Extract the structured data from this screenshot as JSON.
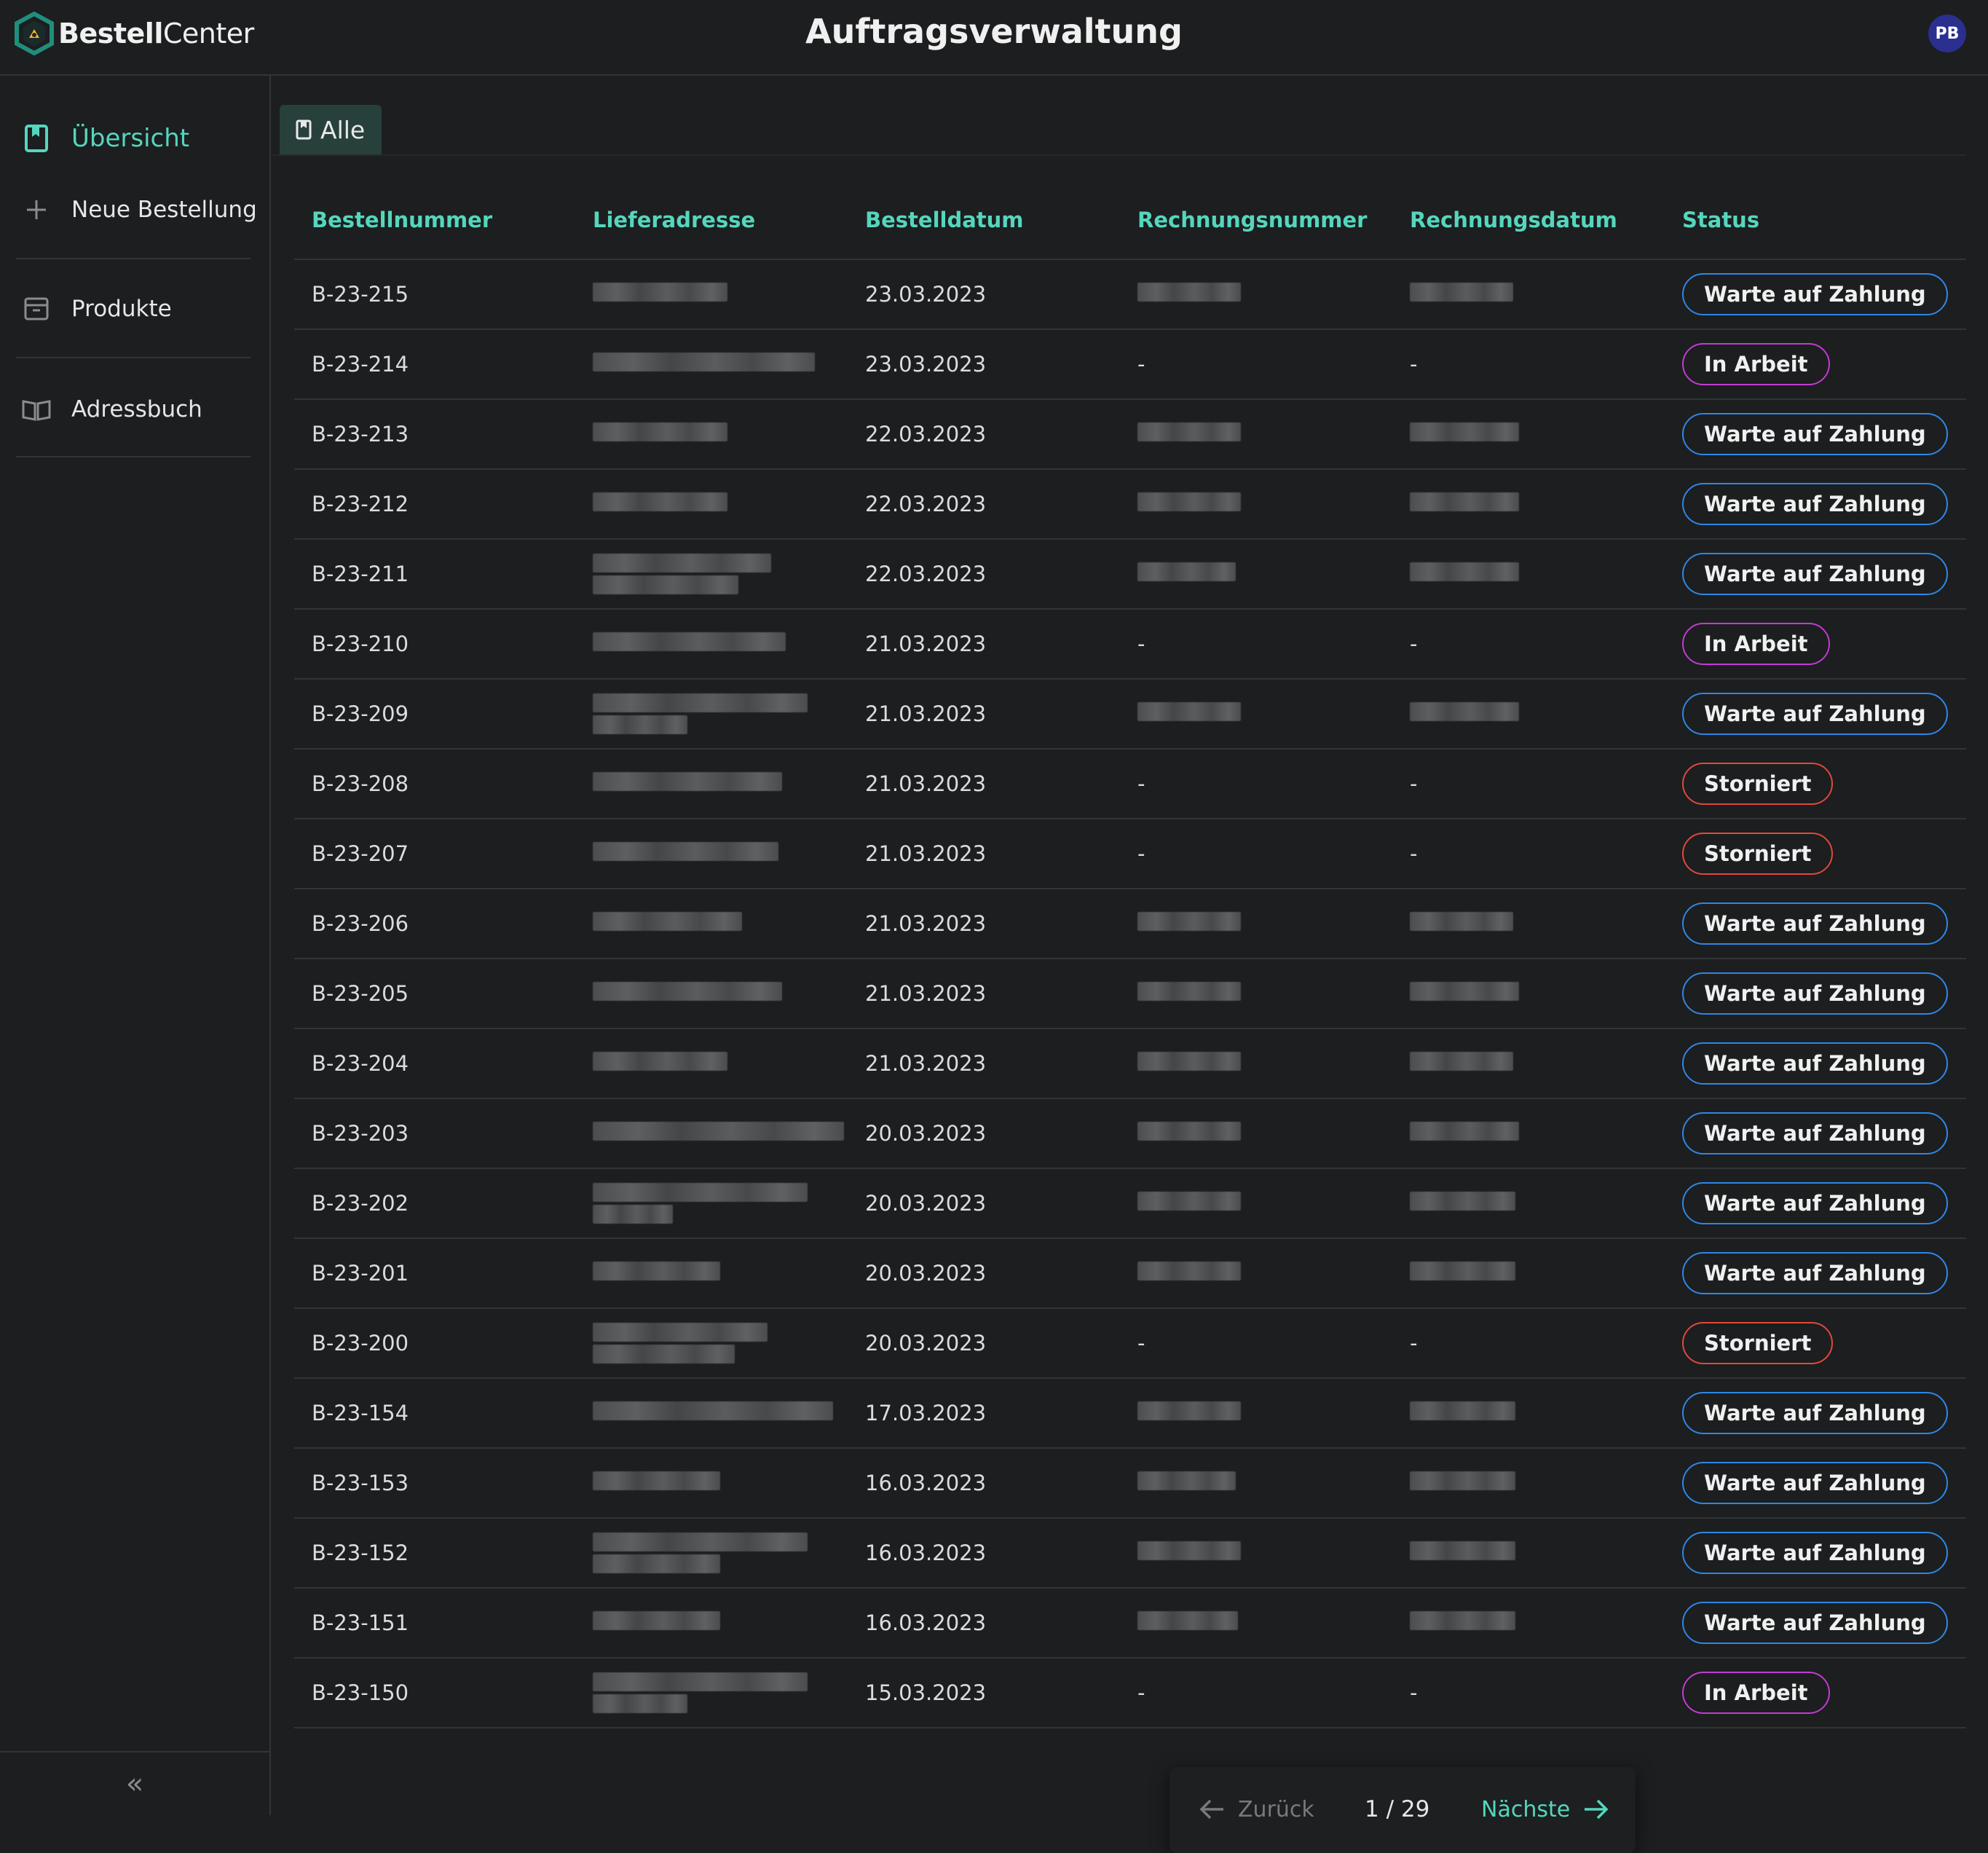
{
  "app": {
    "brand_bold": "Bestell",
    "brand_light": "Center",
    "page_title": "Auftragsverwaltung",
    "avatar_initials": "PB"
  },
  "sidebar": {
    "items": [
      {
        "label": "Übersicht",
        "icon": "bookmark-icon",
        "active": true
      },
      {
        "label": "Neue Bestellung",
        "icon": "plus-icon"
      },
      {
        "label": "Produkte",
        "icon": "archive-icon"
      },
      {
        "label": "Adressbuch",
        "icon": "open-book-icon"
      }
    ],
    "collapse_label": "«"
  },
  "tabs": [
    {
      "label": "Alle",
      "icon": "bookmark-icon"
    }
  ],
  "table": {
    "columns": [
      "Bestellnummer",
      "Lieferadresse",
      "Bestelldatum",
      "Rechnungsnummer",
      "Rechnungsdatum",
      "Status"
    ],
    "rows": [
      {
        "id": "B-23-215",
        "date": "23.03.2023",
        "inv_no": "",
        "inv_date": "",
        "status": "Warte auf Zahlung",
        "tone": "blue"
      },
      {
        "id": "B-23-214",
        "date": "23.03.2023",
        "inv_no": "-",
        "inv_date": "-",
        "status": "In Arbeit",
        "tone": "purple"
      },
      {
        "id": "B-23-213",
        "date": "22.03.2023",
        "inv_no": "",
        "inv_date": "",
        "status": "Warte auf Zahlung",
        "tone": "blue"
      },
      {
        "id": "B-23-212",
        "date": "22.03.2023",
        "inv_no": "",
        "inv_date": "",
        "status": "Warte auf Zahlung",
        "tone": "blue"
      },
      {
        "id": "B-23-211",
        "date": "22.03.2023",
        "inv_no": "",
        "inv_date": "",
        "status": "Warte auf Zahlung",
        "tone": "blue"
      },
      {
        "id": "B-23-210",
        "date": "21.03.2023",
        "inv_no": "-",
        "inv_date": "-",
        "status": "In Arbeit",
        "tone": "purple"
      },
      {
        "id": "B-23-209",
        "date": "21.03.2023",
        "inv_no": "",
        "inv_date": "",
        "status": "Warte auf Zahlung",
        "tone": "blue"
      },
      {
        "id": "B-23-208",
        "date": "21.03.2023",
        "inv_no": "-",
        "inv_date": "-",
        "status": "Storniert",
        "tone": "red"
      },
      {
        "id": "B-23-207",
        "date": "21.03.2023",
        "inv_no": "-",
        "inv_date": "-",
        "status": "Storniert",
        "tone": "red"
      },
      {
        "id": "B-23-206",
        "date": "21.03.2023",
        "inv_no": "",
        "inv_date": "",
        "status": "Warte auf Zahlung",
        "tone": "blue"
      },
      {
        "id": "B-23-205",
        "date": "21.03.2023",
        "inv_no": "",
        "inv_date": "",
        "status": "Warte auf Zahlung",
        "tone": "blue"
      },
      {
        "id": "B-23-204",
        "date": "21.03.2023",
        "inv_no": "",
        "inv_date": "",
        "status": "Warte auf Zahlung",
        "tone": "blue"
      },
      {
        "id": "B-23-203",
        "date": "20.03.2023",
        "inv_no": "",
        "inv_date": "",
        "status": "Warte auf Zahlung",
        "tone": "blue"
      },
      {
        "id": "B-23-202",
        "date": "20.03.2023",
        "inv_no": "",
        "inv_date": "",
        "status": "Warte auf Zahlung",
        "tone": "blue"
      },
      {
        "id": "B-23-201",
        "date": "20.03.2023",
        "inv_no": "",
        "inv_date": "",
        "status": "Warte auf Zahlung",
        "tone": "blue"
      },
      {
        "id": "B-23-200",
        "date": "20.03.2023",
        "inv_no": "-",
        "inv_date": "-",
        "status": "Storniert",
        "tone": "red"
      },
      {
        "id": "B-23-154",
        "date": "17.03.2023",
        "inv_no": "",
        "inv_date": "",
        "status": "Warte auf Zahlung",
        "tone": "blue"
      },
      {
        "id": "B-23-153",
        "date": "16.03.2023",
        "inv_no": "",
        "inv_date": "",
        "status": "Warte auf Zahlung",
        "tone": "blue"
      },
      {
        "id": "B-23-152",
        "date": "16.03.2023",
        "inv_no": "",
        "inv_date": "",
        "status": "Warte auf Zahlung",
        "tone": "blue"
      },
      {
        "id": "B-23-151",
        "date": "16.03.2023",
        "inv_no": "",
        "inv_date": "",
        "status": "Warte auf Zahlung",
        "tone": "blue"
      },
      {
        "id": "B-23-150",
        "date": "15.03.2023",
        "inv_no": "-",
        "inv_date": "-",
        "status": "In Arbeit",
        "tone": "purple"
      }
    ]
  },
  "pagination": {
    "prev_label": "Zurück",
    "next_label": "Nächste",
    "page_indicator": "1 / 29"
  },
  "colors": {
    "accent": "#55d6bd",
    "status_blue": "#2f86e6",
    "status_purple": "#c33bd4",
    "status_red": "#e2483a"
  }
}
